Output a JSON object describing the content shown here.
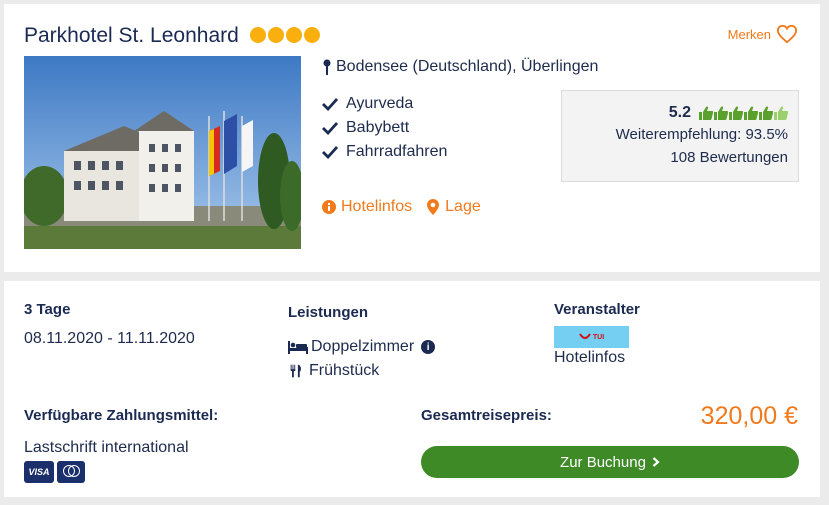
{
  "hotel": {
    "name": "Parkhotel St. Leonhard",
    "stars": 4,
    "merken_label": "Merken",
    "location": "Bodensee (Deutschland), Überlingen",
    "features": [
      "Ayurveda",
      "Babybett",
      "Fahrradfahren"
    ],
    "links": [
      {
        "label": "Hotelinfos",
        "icon": "info-circle-icon"
      },
      {
        "label": "Lage",
        "icon": "map-pin-icon"
      }
    ],
    "rating": {
      "score": "5.2",
      "thumbs": 6,
      "recommendation": "Weiterempfehlung: 93.5%",
      "reviews": "108 Bewertungen"
    }
  },
  "offer": {
    "duration_label": "3 Tage",
    "dates": "08.11.2020 - 11.11.2020",
    "services_label": "Leistungen",
    "services": [
      {
        "label": "Doppelzimmer",
        "icon": "bed-icon"
      },
      {
        "label": "Frühstück",
        "icon": "cutlery-icon"
      }
    ],
    "operator_label": "Veranstalter",
    "operator_logo_text": "TUI",
    "operator_link": "Hotelinfos",
    "payment_label": "Verfügbare Zahlungsmittel:",
    "payment_method": "Lastschrift international",
    "payment_icons": [
      "VISA",
      "mastercard"
    ],
    "total_label": "Gesamtreisepreis:",
    "price": "320,00 €",
    "book_button": "Zur Buchung"
  },
  "colors": {
    "accent": "#f07a1c",
    "star": "#f9b00f",
    "button": "#3d8a27",
    "navy": "#1b2a52",
    "thumb": "#5aa02c"
  }
}
